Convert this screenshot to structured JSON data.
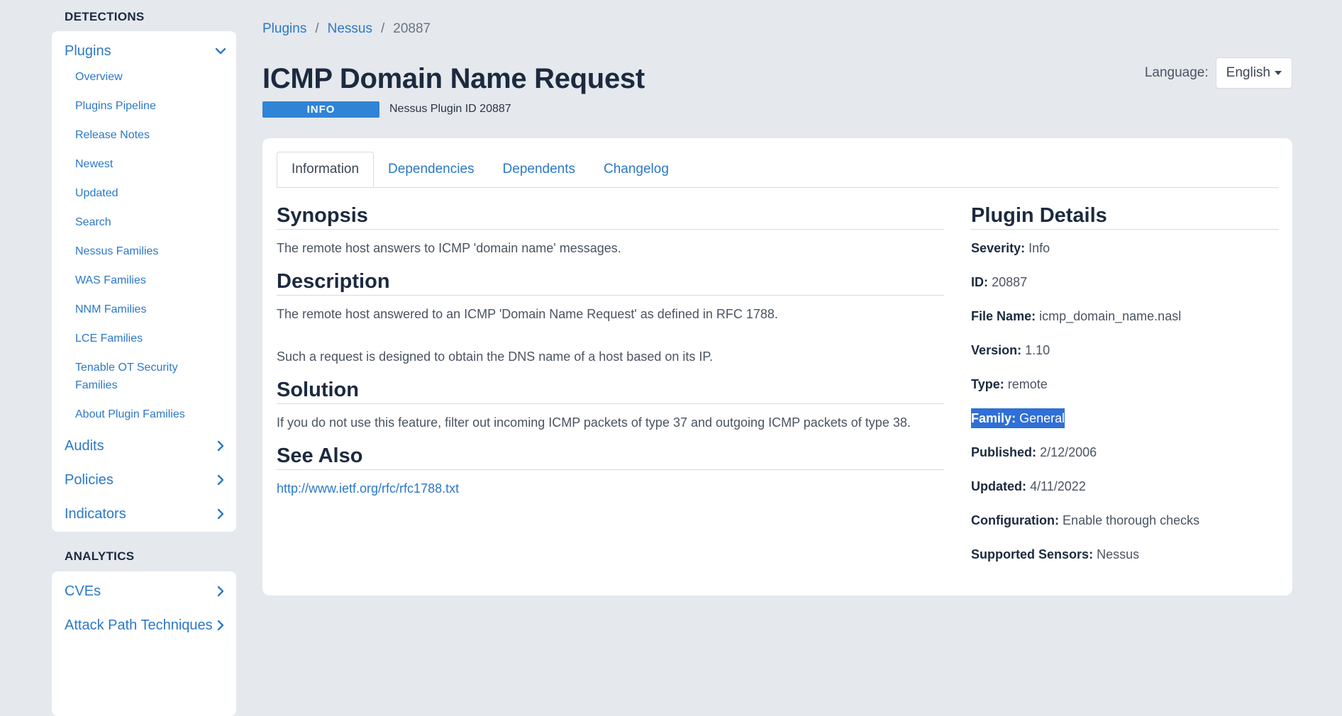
{
  "sidebar": {
    "detections_heading": "DETECTIONS",
    "plugins_label": "Plugins",
    "plugin_items": [
      {
        "label": "Overview"
      },
      {
        "label": "Plugins Pipeline"
      },
      {
        "label": "Release Notes"
      },
      {
        "label": "Newest"
      },
      {
        "label": "Updated"
      },
      {
        "label": "Search"
      },
      {
        "label": "Nessus Families"
      },
      {
        "label": "WAS Families"
      },
      {
        "label": "NNM Families"
      },
      {
        "label": "LCE Families"
      },
      {
        "label": "Tenable OT Security Families"
      },
      {
        "label": "About Plugin Families"
      }
    ],
    "audits_label": "Audits",
    "policies_label": "Policies",
    "indicators_label": "Indicators",
    "analytics_heading": "ANALYTICS",
    "cves_label": "CVEs",
    "attack_path_label": "Attack Path Techniques"
  },
  "breadcrumb": {
    "items": [
      "Plugins",
      "Nessus",
      "20887"
    ],
    "separator": "/"
  },
  "header": {
    "title": "ICMP Domain Name Request",
    "severity_badge": "INFO",
    "plugin_id_text": "Nessus Plugin ID 20887",
    "language_label": "Language:",
    "language_value": "English"
  },
  "tabs": [
    {
      "label": "Information"
    },
    {
      "label": "Dependencies"
    },
    {
      "label": "Dependents"
    },
    {
      "label": "Changelog"
    }
  ],
  "content": {
    "synopsis_heading": "Synopsis",
    "synopsis_text": "The remote host answers to ICMP 'domain name' messages.",
    "description_heading": "Description",
    "description_p1": "The remote host answered to an ICMP 'Domain Name Request' as defined in RFC 1788.",
    "description_p2": "Such a request is designed to obtain the DNS name of a host based on its IP.",
    "solution_heading": "Solution",
    "solution_text": "If you do not use this feature, filter out incoming ICMP packets of type 37 and outgoing ICMP packets of type 38.",
    "see_also_heading": "See Also",
    "see_also_link": "http://www.ietf.org/rfc/rfc1788.txt"
  },
  "details": {
    "heading": "Plugin Details",
    "severity_k": "Severity:",
    "severity_v": "Info",
    "id_k": "ID:",
    "id_v": "20887",
    "file_k": "File Name:",
    "file_v": "icmp_domain_name.nasl",
    "version_k": "Version:",
    "version_v": "1.10",
    "type_k": "Type:",
    "type_v": "remote",
    "family_k": "Family:",
    "family_v": "General",
    "published_k": "Published:",
    "published_v": "2/12/2006",
    "updated_k": "Updated:",
    "updated_v": "4/11/2022",
    "config_k": "Configuration:",
    "config_v": "Enable thorough checks",
    "sensors_k": "Supported Sensors:",
    "sensors_v": "Nessus"
  },
  "colors": {
    "accent": "#2c78c7",
    "badge": "#2f84d6",
    "selection": "#2f6fd6",
    "page_bg": "#e5e8ed"
  }
}
